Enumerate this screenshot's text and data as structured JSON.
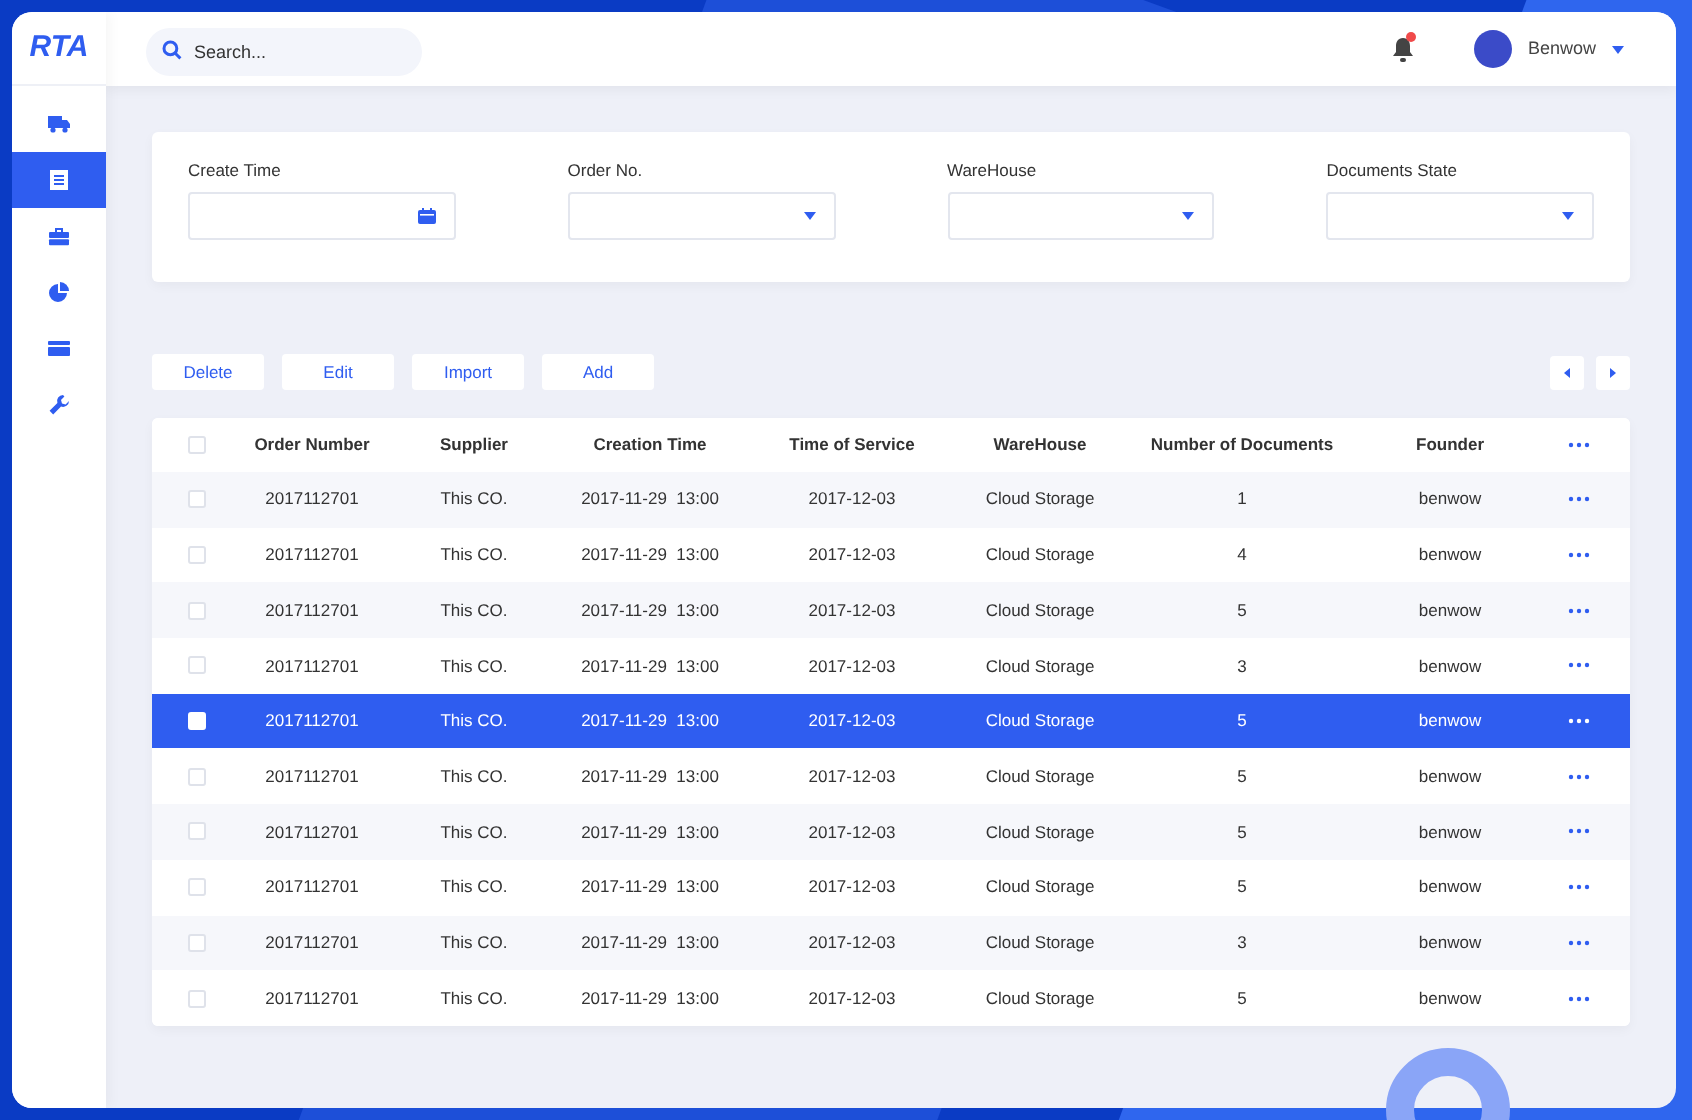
{
  "sidebar": {
    "logo": "RTA",
    "items": [
      {
        "kind": "truck",
        "selected": false
      },
      {
        "kind": "document",
        "selected": true
      },
      {
        "kind": "briefcase",
        "selected": false
      },
      {
        "kind": "pie",
        "selected": false
      },
      {
        "kind": "card",
        "selected": false
      },
      {
        "kind": "wrench",
        "selected": false
      }
    ]
  },
  "header": {
    "search": {
      "placeholder": "Search..."
    },
    "notification_badge": true,
    "user": {
      "name": "Benwow"
    }
  },
  "filters": [
    {
      "label": "Create Time",
      "kind": "date"
    },
    {
      "label": "Order No.",
      "kind": "select"
    },
    {
      "label": "WareHouse",
      "kind": "select"
    },
    {
      "label": "Documents State",
      "kind": "select"
    }
  ],
  "actions": [
    "Delete",
    "Edit",
    "Import",
    "Add"
  ],
  "table": {
    "select_all": {
      "checked": false
    },
    "columns": [
      "Order Number",
      "Supplier",
      "Creation Time",
      "Time of Service",
      "WareHouse",
      "Number of Documents",
      "Founder"
    ],
    "rows": [
      {
        "cells": [
          "2017112701",
          "This CO.",
          "2017-11-29  13:00",
          "2017-12-03",
          "Cloud Storage",
          "1",
          "benwow"
        ],
        "selected": false,
        "checked": false
      },
      {
        "cells": [
          "2017112701",
          "This CO.",
          "2017-11-29  13:00",
          "2017-12-03",
          "Cloud Storage",
          "4",
          "benwow"
        ],
        "selected": false,
        "checked": false
      },
      {
        "cells": [
          "2017112701",
          "This CO.",
          "2017-11-29  13:00",
          "2017-12-03",
          "Cloud Storage",
          "5",
          "benwow"
        ],
        "selected": false,
        "checked": false
      },
      {
        "cells": [
          "2017112701",
          "This CO.",
          "2017-11-29  13:00",
          "2017-12-03",
          "Cloud Storage",
          "3",
          "benwow"
        ],
        "selected": false,
        "checked": false
      },
      {
        "cells": [
          "2017112701",
          "This CO.",
          "2017-11-29  13:00",
          "2017-12-03",
          "Cloud Storage",
          "5",
          "benwow"
        ],
        "selected": true,
        "checked": false
      },
      {
        "cells": [
          "2017112701",
          "This CO.",
          "2017-11-29  13:00",
          "2017-12-03",
          "Cloud Storage",
          "5",
          "benwow"
        ],
        "selected": false,
        "checked": false
      },
      {
        "cells": [
          "2017112701",
          "This CO.",
          "2017-11-29  13:00",
          "2017-12-03",
          "Cloud Storage",
          "5",
          "benwow"
        ],
        "selected": false,
        "checked": false
      },
      {
        "cells": [
          "2017112701",
          "This CO.",
          "2017-11-29  13:00",
          "2017-12-03",
          "Cloud Storage",
          "5",
          "benwow"
        ],
        "selected": false,
        "checked": false
      },
      {
        "cells": [
          "2017112701",
          "This CO.",
          "2017-11-29  13:00",
          "2017-12-03",
          "Cloud Storage",
          "3",
          "benwow"
        ],
        "selected": false,
        "checked": false
      },
      {
        "cells": [
          "2017112701",
          "This CO.",
          "2017-11-29  13:00",
          "2017-12-03",
          "Cloud Storage",
          "5",
          "benwow"
        ],
        "selected": false,
        "checked": false
      }
    ]
  }
}
